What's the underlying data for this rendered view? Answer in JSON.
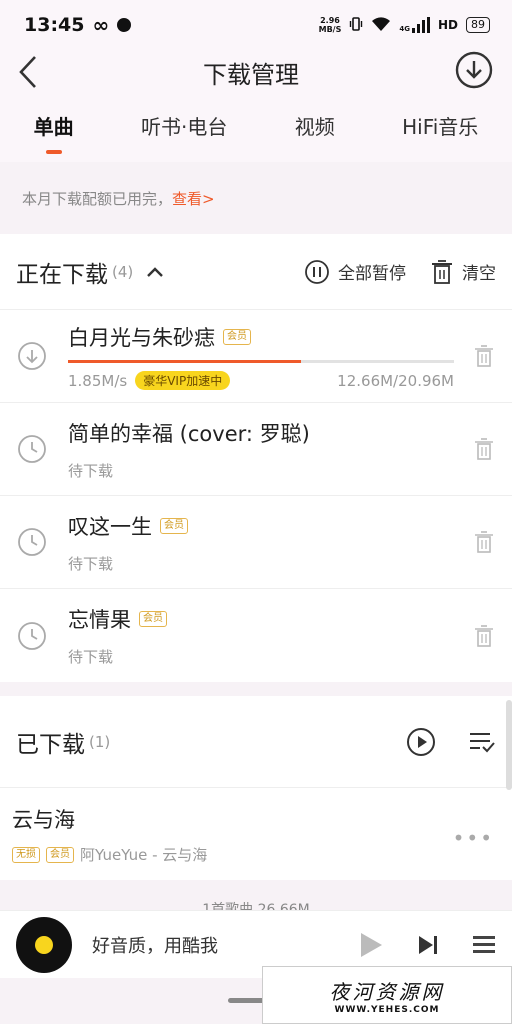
{
  "status_bar": {
    "time": "13:45",
    "speed_top": "2.96",
    "speed_bottom": "MB/S",
    "network": "4G",
    "hd": "HD",
    "battery": "89"
  },
  "header": {
    "title": "下载管理"
  },
  "tabs": [
    {
      "label": "单曲",
      "active": true
    },
    {
      "label": "听书·电台",
      "active": false
    },
    {
      "label": "视频",
      "active": false
    },
    {
      "label": "HiFi音乐",
      "active": false
    }
  ],
  "quota": {
    "text": "本月下载配额已用完，",
    "link": "查看>"
  },
  "downloading": {
    "title": "正在下载",
    "count": "(4)",
    "pause_all": "全部暂停",
    "clear": "清空",
    "items": [
      {
        "title": "白月光与朱砂痣",
        "tag": "会员",
        "speed": "1.85M/s",
        "boost": "豪华VIP加速中",
        "size": "12.66M/20.96M",
        "progress": 0.604,
        "state": "downloading"
      },
      {
        "title": "简单的幸福 (cover: 罗聪)",
        "tag": "",
        "status": "待下载",
        "state": "waiting"
      },
      {
        "title": "叹这一生",
        "tag": "会员",
        "status": "待下载",
        "state": "waiting"
      },
      {
        "title": "忘情果",
        "tag": "会员",
        "status": "待下载",
        "state": "waiting"
      }
    ]
  },
  "downloaded": {
    "title": "已下载",
    "count": "(1)",
    "items": [
      {
        "title": "云与海",
        "tag1": "无损",
        "tag2": "会员",
        "subtitle": "阿YueYue - 云与海"
      }
    ],
    "summary": "1首歌曲 26.66M"
  },
  "player": {
    "text": "好音质，用酷我"
  },
  "watermark": {
    "main": "夜河资源网",
    "sub": "WWW.YEHES.COM"
  },
  "colors": {
    "accent": "#ef5a2a",
    "vip_gold": "#f8d51e",
    "background": "#f7f2f6"
  }
}
